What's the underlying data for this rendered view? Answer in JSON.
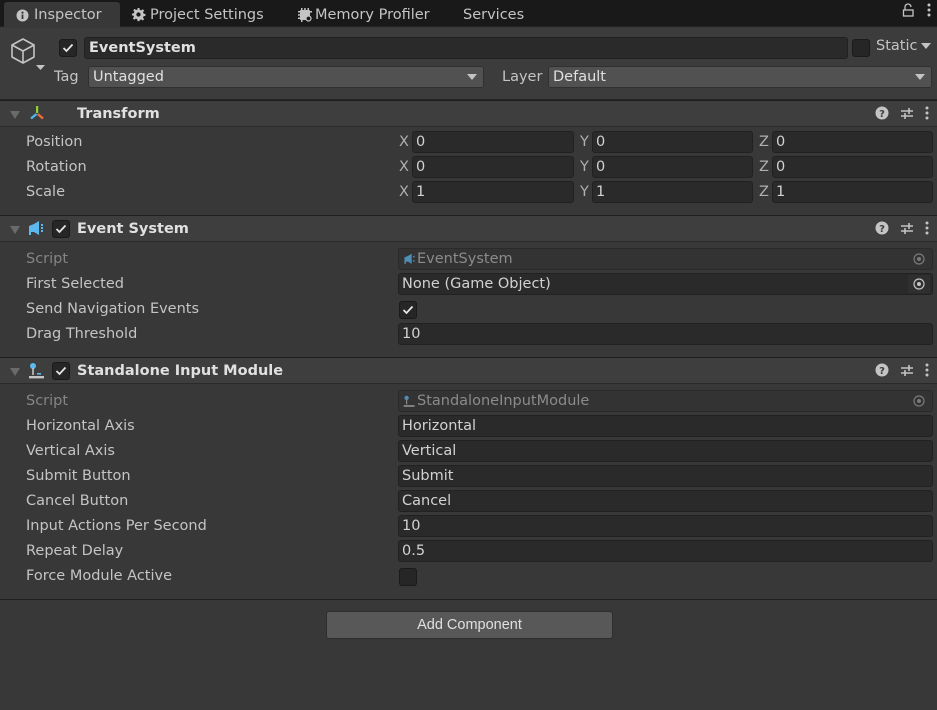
{
  "tabs": [
    {
      "label": "Inspector",
      "icon": "info-icon",
      "active": true
    },
    {
      "label": "Project Settings",
      "icon": "gear-icon",
      "active": false
    },
    {
      "label": "Memory Profiler",
      "icon": "chip-icon",
      "active": false
    },
    {
      "label": "Services",
      "icon": "",
      "active": false
    }
  ],
  "tabbar_icons": [
    "lock-icon",
    "more-vert-icon"
  ],
  "header": {
    "object_active": true,
    "object_name": "EventSystem",
    "static_label": "Static",
    "static_checked": false,
    "tag_label": "Tag",
    "tag_value": "Untagged",
    "layer_label": "Layer",
    "layer_value": "Default"
  },
  "transform": {
    "title": "Transform",
    "rows": [
      {
        "label": "Position",
        "x": "0",
        "y": "0",
        "z": "0"
      },
      {
        "label": "Rotation",
        "x": "0",
        "y": "0",
        "z": "0"
      },
      {
        "label": "Scale",
        "x": "1",
        "y": "1",
        "z": "1"
      }
    ],
    "axis_labels": {
      "x": "X",
      "y": "Y",
      "z": "Z"
    }
  },
  "event_system": {
    "title": "Event System",
    "enabled": true,
    "script_label": "Script",
    "script_value": "EventSystem",
    "first_selected_label": "First Selected",
    "first_selected_value": "None (Game Object)",
    "send_nav_label": "Send Navigation Events",
    "send_nav_checked": true,
    "drag_threshold_label": "Drag Threshold",
    "drag_threshold_value": "10"
  },
  "standalone_input": {
    "title": "Standalone Input Module",
    "enabled": true,
    "script_label": "Script",
    "script_value": "StandaloneInputModule",
    "fields": [
      {
        "label": "Horizontal Axis",
        "value": "Horizontal"
      },
      {
        "label": "Vertical Axis",
        "value": "Vertical"
      },
      {
        "label": "Submit Button",
        "value": "Submit"
      },
      {
        "label": "Cancel Button",
        "value": "Cancel"
      },
      {
        "label": "Input Actions Per Second",
        "value": "10"
      },
      {
        "label": "Repeat Delay",
        "value": "0.5"
      }
    ],
    "force_active_label": "Force Module Active",
    "force_active_checked": false
  },
  "add_component_label": "Add Component",
  "colors": {
    "panel_bg": "#383838",
    "field_bg": "#2a2a2a",
    "event_icon": "#5cb8f0",
    "transform_icon_green": "#8ed233",
    "transform_icon_blue": "#4fb7ee",
    "transform_icon_red": "#ef6b3a"
  }
}
